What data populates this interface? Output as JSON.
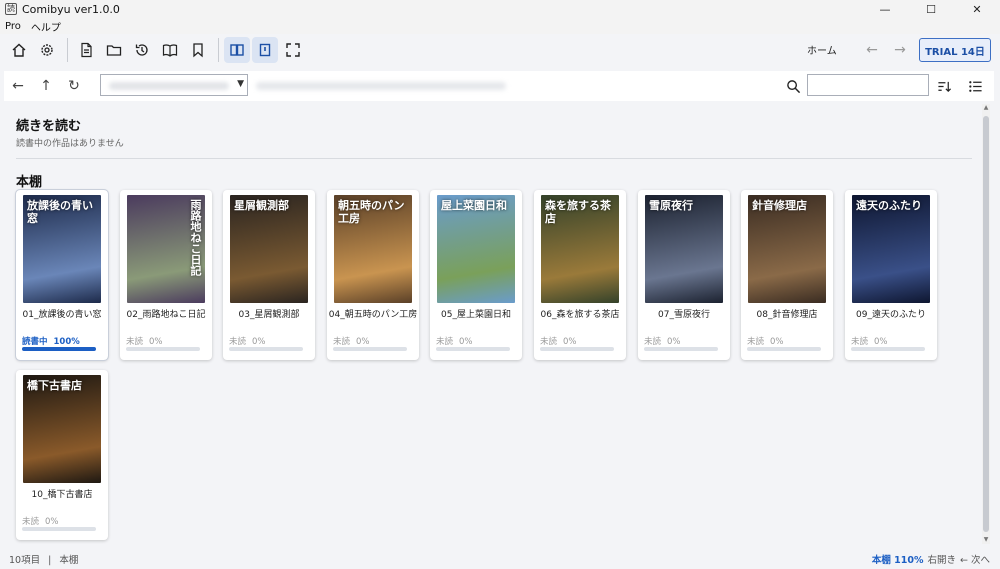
{
  "window": {
    "title": "Comibyu ver1.0.0",
    "icon": "app-icon",
    "minimize": "—",
    "maximize": "☐",
    "close": "✕"
  },
  "menu": [
    {
      "label": "Pro"
    },
    {
      "label": "ヘルプ"
    }
  ],
  "toolbar": {
    "home_label": "ホーム",
    "back_arrow": "←",
    "forward_arrow": "→",
    "trial_label": "TRIAL 14日",
    "accent": "#3d6fc4"
  },
  "pathbar": {
    "back": "←",
    "up": "↑",
    "reload": "↻",
    "search_placeholder": ""
  },
  "continue_section": {
    "title": "続きを読む",
    "subtitle": "読書中の作品はありません"
  },
  "shelf_section": {
    "title": "本棚"
  },
  "books": [
    {
      "name": "01_放課後の青い窓",
      "cover_title": "放課後の青い窓",
      "status": "読書中",
      "percent": "100%",
      "progress": 1.0,
      "reading": true,
      "colors": [
        "#1d2a4a",
        "#6a86b8"
      ]
    },
    {
      "name": "02_雨路地ねこ日記",
      "cover_title": "雨路地ねこ日記",
      "status": "未読",
      "percent": "0%",
      "progress": 0,
      "reading": false,
      "colors": [
        "#4b3b5e",
        "#8a9a78"
      ]
    },
    {
      "name": "03_星屑観測部",
      "cover_title": "星屑観測部",
      "status": "未読",
      "percent": "0%",
      "progress": 0,
      "reading": false,
      "colors": [
        "#2a2420",
        "#7a5a32"
      ]
    },
    {
      "name": "04_朝五時のパン工房",
      "cover_title": "朝五時のパン工房",
      "status": "未読",
      "percent": "0%",
      "progress": 0,
      "reading": false,
      "colors": [
        "#5a4028",
        "#c99450"
      ]
    },
    {
      "name": "05_屋上菜園日和",
      "cover_title": "屋上菜園日和",
      "status": "未読",
      "percent": "0%",
      "progress": 0,
      "reading": false,
      "colors": [
        "#6a9ccc",
        "#7aa05a"
      ]
    },
    {
      "name": "06_森を旅する茶店",
      "cover_title": "森を旅する茶店",
      "status": "未読",
      "percent": "0%",
      "progress": 0,
      "reading": false,
      "colors": [
        "#34422a",
        "#9a7a3a"
      ]
    },
    {
      "name": "07_雪原夜行",
      "cover_title": "雪原夜行",
      "status": "未読",
      "percent": "0%",
      "progress": 0,
      "reading": false,
      "colors": [
        "#1c2230",
        "#6a7690"
      ]
    },
    {
      "name": "08_針音修理店",
      "cover_title": "針音修理店",
      "status": "未読",
      "percent": "0%",
      "progress": 0,
      "reading": false,
      "colors": [
        "#3a2c22",
        "#8a6a48"
      ]
    },
    {
      "name": "09_遠天のふたり",
      "cover_title": "遠天のふたり",
      "status": "未読",
      "percent": "0%",
      "progress": 0,
      "reading": false,
      "colors": [
        "#0e1630",
        "#3a5088"
      ]
    },
    {
      "name": "10_橋下古書店",
      "cover_title": "橋下古書店",
      "status": "未読",
      "percent": "0%",
      "progress": 0,
      "reading": false,
      "colors": [
        "#1e1812",
        "#8a5a2a"
      ]
    }
  ],
  "statusbar": {
    "count": "10項目",
    "separator": "|",
    "location": "本棚",
    "zoom": "本棚 110%",
    "reading_direction": "右開き",
    "next": "← 次へ"
  }
}
